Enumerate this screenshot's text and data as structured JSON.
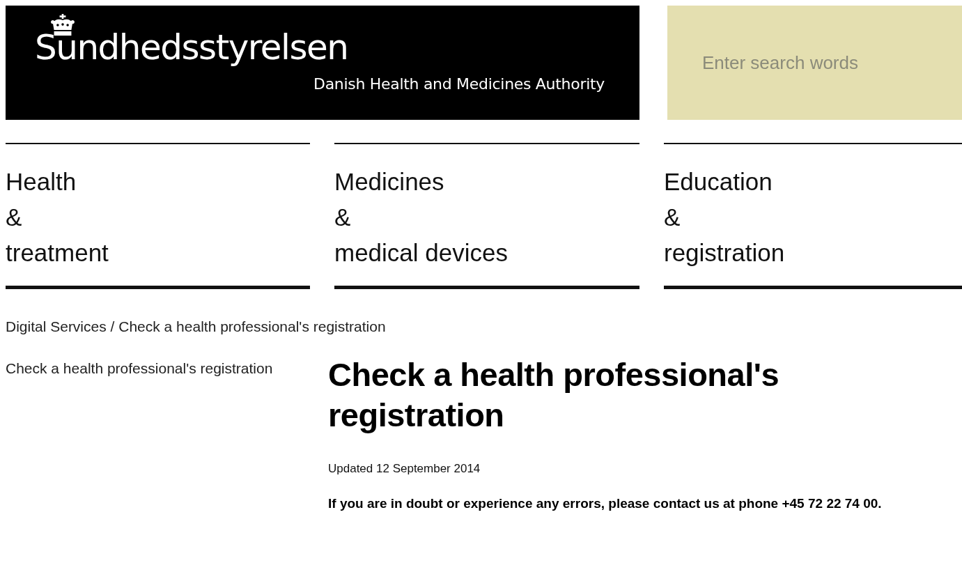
{
  "header": {
    "logo_name": "Sundhedsstyrelsen",
    "logo_subtitle": "Danish Health and Medicines Authority"
  },
  "search": {
    "placeholder": "Enter search words"
  },
  "nav": [
    {
      "label": "Health\n&\ntreatment"
    },
    {
      "label": "Medicines\n&\nmedical devices"
    },
    {
      "label": "Education\n&\nregistration"
    }
  ],
  "breadcrumb": "Digital Services / Check a health professional's registration",
  "sidebar": {
    "items": [
      {
        "label": "Check a health professional's registration"
      }
    ]
  },
  "article": {
    "title": "Check a health professional's registration",
    "updated": "Updated 12 September 2014",
    "notice": "If you are in doubt or experience any errors, please contact us at phone +45 72 22 74 00."
  }
}
